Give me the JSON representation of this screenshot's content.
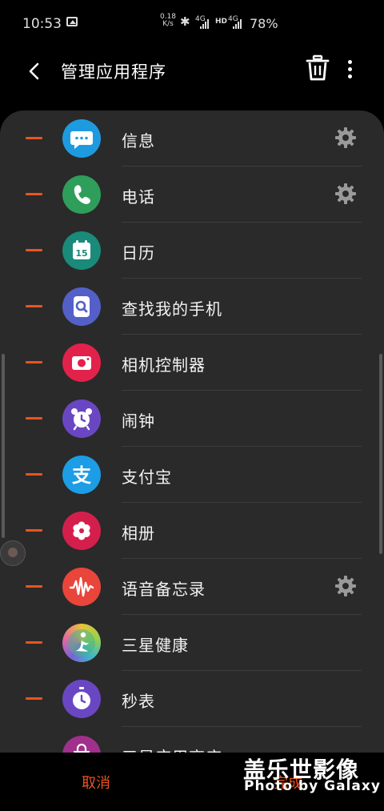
{
  "status_bar": {
    "time": "10:53",
    "net_speed_value": "0.18",
    "net_speed_unit": "K/s",
    "signal1": "4G",
    "hd": "HD",
    "signal2": "4G",
    "battery": "78%"
  },
  "header": {
    "title": "管理应用程序",
    "back_icon": "back-arrow-icon",
    "delete_icon": "trash-icon",
    "more_icon": "more-vertical-icon"
  },
  "apps": [
    {
      "label": "信息",
      "icon": "messages-icon",
      "color": "#1e9be0",
      "has_settings": true
    },
    {
      "label": "电话",
      "icon": "phone-icon",
      "color": "#2f9e5b",
      "has_settings": true
    },
    {
      "label": "日历",
      "icon": "calendar-icon",
      "color": "#1a8a7a",
      "icon_text": "15",
      "has_settings": false
    },
    {
      "label": "查找我的手机",
      "icon": "find-my-phone-icon",
      "color": "#5460c8",
      "has_settings": false
    },
    {
      "label": "相机控制器",
      "icon": "camera-controller-icon",
      "color": "#e2224b",
      "has_settings": false
    },
    {
      "label": "闹钟",
      "icon": "alarm-icon",
      "color": "#6a47c2",
      "has_settings": false
    },
    {
      "label": "支付宝",
      "icon": "alipay-icon",
      "color": "#1c9de6",
      "icon_text": "支",
      "has_settings": false
    },
    {
      "label": "相册",
      "icon": "gallery-icon",
      "color": "#d41f4d",
      "has_settings": false
    },
    {
      "label": "语音备忘录",
      "icon": "voice-recorder-icon",
      "color": "#e9453a",
      "has_settings": true
    },
    {
      "label": "三星健康",
      "icon": "samsung-health-icon",
      "color": "#45b58a",
      "has_settings": false
    },
    {
      "label": "秒表",
      "icon": "stopwatch-icon",
      "color": "#6a47c2",
      "has_settings": false
    },
    {
      "label": "三星应用商店",
      "icon": "galaxy-store-icon",
      "color": "#a0308c",
      "has_settings": false
    }
  ],
  "colors": {
    "accent": "#e9541f",
    "panel": "#2a2a2a",
    "background": "#000000"
  },
  "footer": {
    "cancel_label": "取消",
    "done_label": "完成"
  },
  "watermark": {
    "title": "盖乐世影像",
    "subtitle": "Photo by Galaxy"
  }
}
